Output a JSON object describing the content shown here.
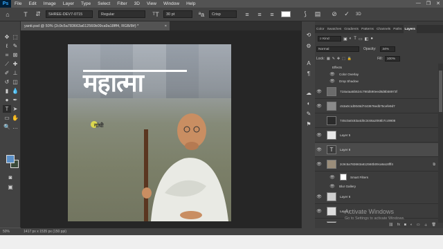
{
  "app": {
    "logo": "Ps"
  },
  "menu": [
    "File",
    "Edit",
    "Image",
    "Layer",
    "Type",
    "Select",
    "Filter",
    "3D",
    "View",
    "Window",
    "Help"
  ],
  "window_controls": [
    "—",
    "❐",
    "✕"
  ],
  "options_bar": {
    "font_family": "SHREE-DEV7-0715",
    "font_style": "Regular",
    "font_size": "30 pt",
    "antialias": "Crisp",
    "mode_3d": "3D"
  },
  "document_tab": {
    "title": "yanti.psd @ 50% (2c9c5a783663a612560b09ca9a18fff4, RGB/8#) *",
    "close": "×"
  },
  "canvas_text": {
    "headline": "महात्मा",
    "small_label": "गांधी"
  },
  "status_bar": {
    "zoom": "50%",
    "doc_size": "1417 px x 1535 px (150 ppi)"
  },
  "panel": {
    "tabs": [
      "Color",
      "Swatches",
      "Gradients",
      "Patterns",
      "Channels",
      "Paths",
      "Layers"
    ],
    "active_tab": "Layers",
    "filter_kind": "Kind",
    "blend_mode": "Normal",
    "opacity_label": "Opacity:",
    "opacity_value": "34%",
    "lock_label": "Lock:",
    "fill_label": "Fill:",
    "fill_value": "100%"
  },
  "layers": [
    {
      "name": "Effects",
      "type": "sub",
      "thumb": ""
    },
    {
      "name": "Color Overlay",
      "type": "sub",
      "thumb": ""
    },
    {
      "name": "Drop Shadow",
      "type": "sub",
      "thumb": ""
    },
    {
      "name": "718a4aa5b524c790d590eed8d8b58973f",
      "type": "layer",
      "thumb": "#6b6b6b"
    },
    {
      "name": "c53a0c1d0048d7443676edb75cefe9d7",
      "type": "layer",
      "thumb": "#8a8a8a"
    },
    {
      "name": "745c0a0c83a4d0c3c66a2068b7cc9908",
      "type": "layer",
      "thumb": "#2b2b2b"
    },
    {
      "name": "Layer 5",
      "type": "layer",
      "thumb": "#e8e8e8"
    },
    {
      "name": "Layer 8",
      "type": "text",
      "thumb": ""
    },
    {
      "name": "2c9c5a783663a612560b09ca9a18fff4",
      "type": "smart",
      "thumb": "#9a8d7a"
    },
    {
      "name": "Smart Filters",
      "type": "sub",
      "thumb": ""
    },
    {
      "name": "Blur Gallery",
      "type": "sub",
      "thumb": ""
    },
    {
      "name": "Layer 6",
      "type": "layer",
      "thumb": "#cfcfcf"
    },
    {
      "name": "Layer 1",
      "type": "layer",
      "thumb": "#dcdcdc"
    },
    {
      "name": "Layer 4",
      "type": "layer",
      "thumb": "#bfbfbf"
    }
  ],
  "watermark": {
    "line1": "Activate Windows",
    "line2": "Go to Settings to activate Windows."
  }
}
